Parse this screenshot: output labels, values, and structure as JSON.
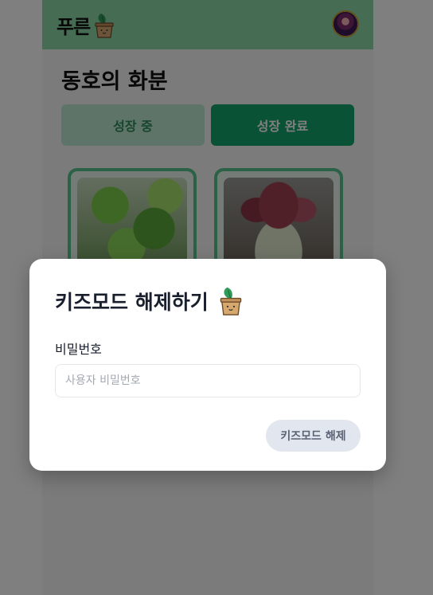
{
  "header": {
    "logo_text": "푸른",
    "logo_icon": "plant-pot-icon",
    "avatar_icon": "user-avatar"
  },
  "main": {
    "title": "동호의 화분",
    "tabs": [
      {
        "label": "성장 중",
        "active": false
      },
      {
        "label": "성장 완료",
        "active": true
      }
    ],
    "plants": [
      {
        "photo": "cucumber-plant-photo"
      },
      {
        "photo": "lettuce-plant-photo"
      }
    ]
  },
  "modal": {
    "title": "키즈모드 해제하기",
    "title_icon": "plant-pot-icon",
    "password_label": "비밀번호",
    "password_value": "",
    "password_placeholder": "사용자 비밀번호",
    "submit_label": "키즈모드 해제"
  },
  "colors": {
    "header_bg": "#8fd8a8",
    "tab_active": "#15a56a",
    "tab_inactive": "#bfe9d0",
    "card_border": "#57c38f",
    "overlay": "rgba(0,0,0,0.5)",
    "button_disabled_bg": "#e2e6ee"
  }
}
